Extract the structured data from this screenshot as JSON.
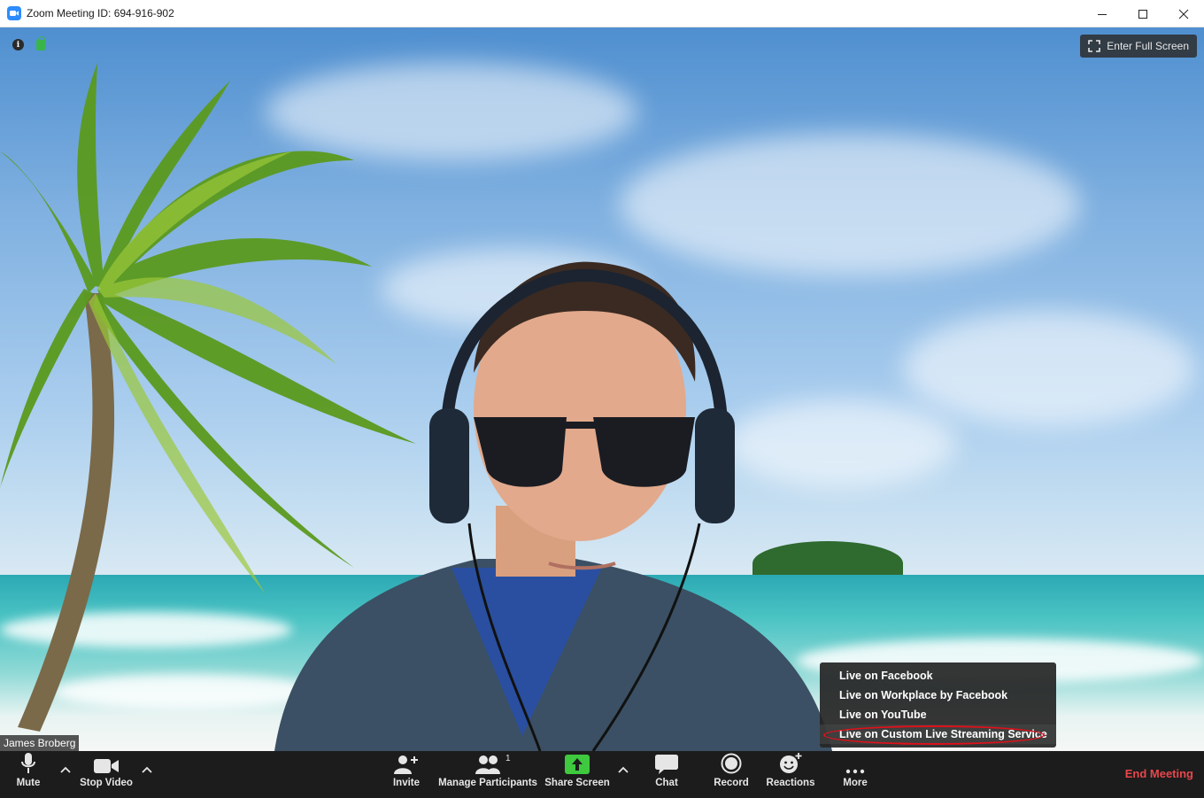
{
  "window": {
    "title": "Zoom Meeting ID: 694-916-902",
    "controls": [
      "minimize",
      "maximize",
      "close"
    ]
  },
  "video": {
    "fullscreen_label": "Enter Full Screen",
    "participant_name": "James Broberg"
  },
  "live_menu": {
    "items": [
      {
        "label": "Live on Facebook"
      },
      {
        "label": "Live on Workplace by Facebook"
      },
      {
        "label": "Live on YouTube"
      },
      {
        "label": "Live on Custom Live Streaming Service",
        "highlighted": true
      }
    ],
    "highlight_color": "#e0101a"
  },
  "toolbar": {
    "mute_label": "Mute",
    "stop_video_label": "Stop Video",
    "invite_label": "Invite",
    "participants_label": "Manage Participants",
    "participants_count": "1",
    "share_label": "Share Screen",
    "chat_label": "Chat",
    "record_label": "Record",
    "reactions_label": "Reactions",
    "more_label": "More",
    "end_label": "End Meeting"
  },
  "colors": {
    "share_green": "#3ec93e",
    "end_red": "#e8474c",
    "toolbar_bg": "#1c1c1c",
    "brand_blue": "#2d8cff"
  }
}
